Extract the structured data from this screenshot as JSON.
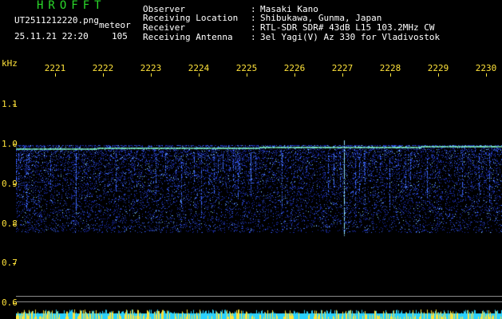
{
  "header": {
    "brand": "HROFFT",
    "filename": "UT2511212220.png",
    "tag": "meteor",
    "datetime": "25.11.21 22:20",
    "count": "105",
    "fields": [
      {
        "label": "Observer",
        "sep": ":",
        "value": "Masaki Kano"
      },
      {
        "label": "Receiving Location",
        "sep": ":",
        "value": "Shibukawa, Gunma, Japan"
      },
      {
        "label": "Receiver",
        "sep": ":",
        "value": "RTL-SDR SDR# 43dB L15 103.2MHz CW"
      },
      {
        "label": "Receiving Antenna",
        "sep": ":",
        "value": "3el Yagi(V) Az 330 for Vladivostok"
      }
    ]
  },
  "axis": {
    "y_unit": "kHz",
    "y_labels": [
      "1.1",
      "1.0",
      "0.9",
      "0.8",
      "0.7",
      "0.6"
    ],
    "x_labels": [
      "2221",
      "2222",
      "2223",
      "2224",
      "2225",
      "2226",
      "2227",
      "2228",
      "2229",
      "2230"
    ]
  },
  "colors": {
    "text_primary": "#ffffff",
    "brand": "#2ad92a",
    "axis": "#ffe33a",
    "signal_low": "#1a2aa8",
    "signal_mid": "#3f6cff",
    "signal_high": "#8fe0ff",
    "carrier": "#7cf0c0",
    "noise_bar": "#2bd2ff",
    "noise_peak": "#ffe33a"
  }
}
